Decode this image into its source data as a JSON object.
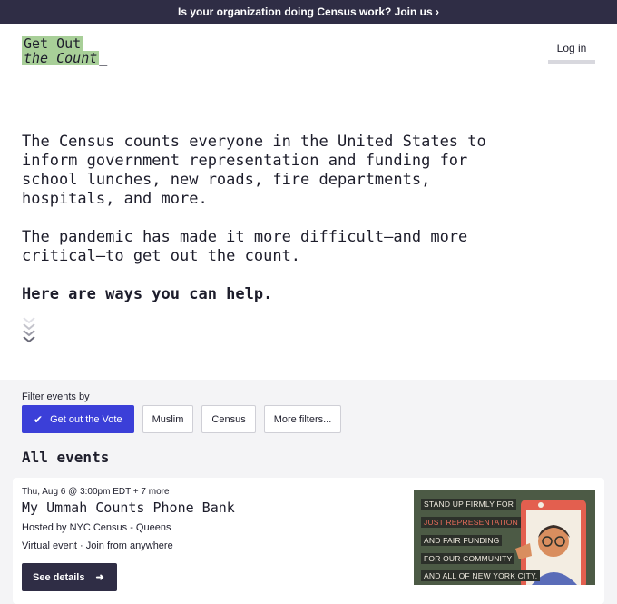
{
  "banner": {
    "text": "Is your organization doing Census work? Join us ›"
  },
  "logo": {
    "line1": "Get Out",
    "line2": "the Count",
    "cursor": "_"
  },
  "header": {
    "login_label": "Log in"
  },
  "hero": {
    "paragraph1": "The Census counts everyone in the United States to inform government representation and funding for school lunches, new roads, fire departments, hospitals, and more.",
    "paragraph2": "The pandemic has made it more difficult—and more critical—to get out the count.",
    "cta": "Here are ways you can help."
  },
  "filters": {
    "label": "Filter events by",
    "chips": [
      {
        "label": "Get out the Vote",
        "active": true
      },
      {
        "label": "Muslim",
        "active": false
      },
      {
        "label": "Census",
        "active": false
      },
      {
        "label": "More filters...",
        "active": false
      }
    ]
  },
  "events": {
    "heading": "All events",
    "items": [
      {
        "date": "Thu, Aug 6 @ 3:00pm EDT + 7 more",
        "title": "My Ummah Counts Phone Bank",
        "host": "Hosted by NYC Census - Queens",
        "location": "Virtual event · Join from anywhere",
        "button_label": "See details",
        "image_lines": [
          "STAND UP FIRMLY FOR",
          "JUST REPRESENTATION",
          "AND FAIR FUNDING",
          "FOR OUR COMMUNITY",
          "AND ALL OF NEW YORK CITY."
        ]
      }
    ]
  },
  "colors": {
    "banner_bg": "#2f2d45",
    "logo_highlight": "#a8cf98",
    "active_chip": "#3b3fd8",
    "button_dark": "#2f2d45",
    "section_bg": "#f4f4f6"
  }
}
